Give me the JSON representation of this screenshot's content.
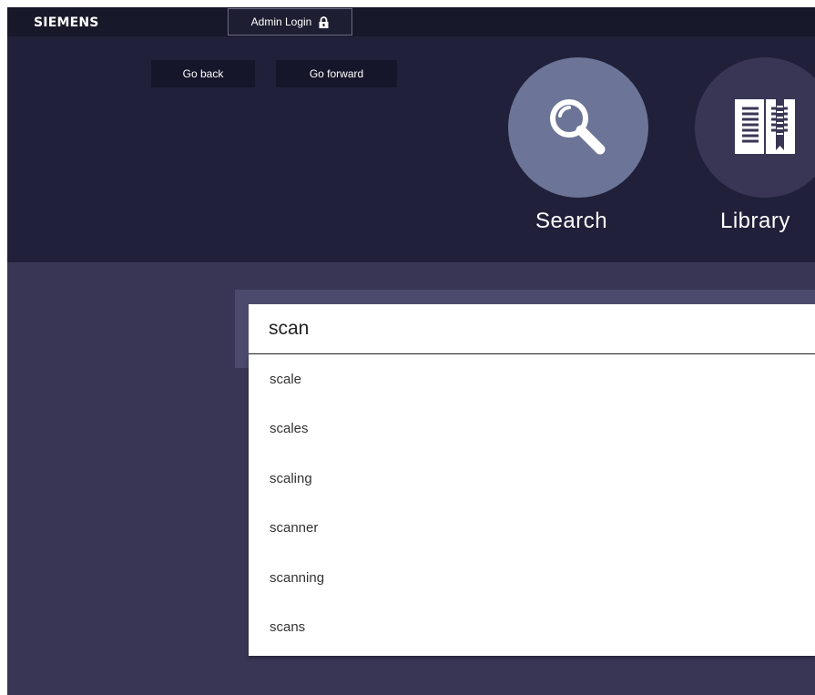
{
  "topbar": {
    "logo": "SIEMENS",
    "admin_login_label": "Admin Login",
    "admin_login_icon": "lock-icon"
  },
  "nav": {
    "back_label": "Go back",
    "forward_label": "Go forward"
  },
  "tiles": [
    {
      "label": "Search",
      "icon": "magnifier-icon",
      "color": "#6c7597"
    },
    {
      "label": "Library",
      "icon": "book-icon",
      "color": "#393655"
    }
  ],
  "search": {
    "value": "scan",
    "suggestions": [
      "scale",
      "scales",
      "scaling",
      "scanner",
      "scanning",
      "scans"
    ]
  },
  "colors": {
    "topbar": "#171829",
    "header": "#21203a",
    "body": "#393655",
    "panel": "#4c4a6c",
    "active_tile": "#6c7597"
  }
}
